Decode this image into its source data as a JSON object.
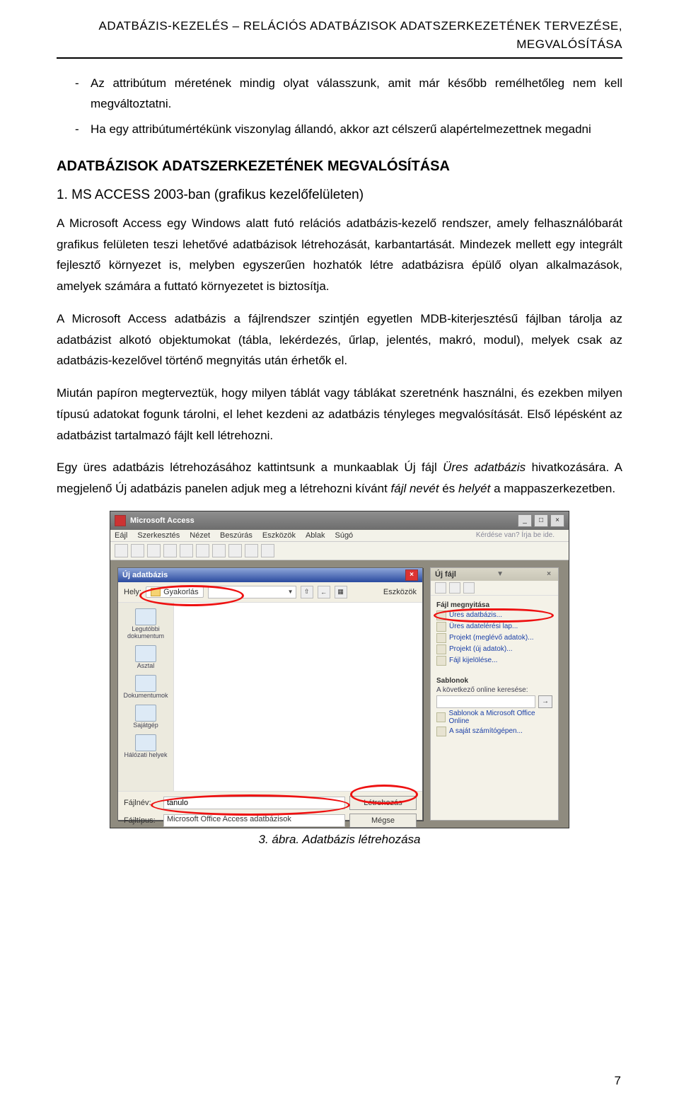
{
  "header": {
    "line1": "ADATBÁZIS-KEZELÉS – RELÁCIÓS ADATBÁZISOK ADATSZERKEZETÉNEK TERVEZÉSE,",
    "line2": "MEGVALÓSÍTÁSA"
  },
  "bullets": {
    "b1": "Az attribútum méretének mindig olyat válasszunk, amit már később remélhetőleg nem kell megváltoztatni.",
    "b2": "Ha egy attribútumértékünk viszonylag állandó, akkor azt célszerű alapértelmezettnek megadni"
  },
  "section": "ADATBÁZISOK ADATSZERKEZETÉNEK MEGVALÓSÍTÁSA",
  "subsection": "1. MS ACCESS 2003-ban (grafikus kezelőfelületen)",
  "paragraphs": {
    "p1": "A Microsoft Access egy Windows alatt futó relációs adatbázis-kezelő rendszer, amely felhasználóbarát grafikus felületen teszi lehetővé adatbázisok létrehozását, karbantartását. Mindezek mellett egy integrált fejlesztő környezet is, melyben egyszerűen hozhatók létre adatbázisra épülő olyan alkalmazások, amelyek számára a futtató környezetet is biztosítja.",
    "p2": "A Microsoft Access adatbázis a fájlrendszer szintjén egyetlen MDB-kiterjesztésű fájlban tárolja az adatbázist alkotó objektumokat (tábla, lekérdezés, űrlap, jelentés, makró, modul), melyek csak az adatbázis-kezelővel történő megnyitás után érhetők el.",
    "p3": "Miután papíron megterveztük, hogy milyen táblát vagy táblákat szeretnénk használni, és ezekben milyen típusú adatokat fogunk tárolni, el lehet kezdeni az adatbázis tényleges megvalósítását. Első lépésként az adatbázist tartalmazó fájlt kell létrehozni.",
    "p4_a": "Egy üres adatbázis létrehozásához kattintsunk a munkaablak Új fájl ",
    "p4_b": "Üres adatbázis",
    "p4_c": " hivatkozására. A megjelenő Új adatbázis panelen adjuk meg a létrehozni kívánt ",
    "p4_d": "fájl nevét",
    "p4_e": " és ",
    "p4_f": "helyét",
    "p4_g": " a mappaszerkezetben."
  },
  "figure": {
    "caption": "3. ábra. Adatbázis létrehozása"
  },
  "app": {
    "title": "Microsoft Access",
    "menus": [
      "Eájl",
      "Szerkesztés",
      "Nézet",
      "Beszúrás",
      "Eszközök",
      "Ablak",
      "Súgó"
    ],
    "question": "Kérdése van? Írja be ide.",
    "dialog": {
      "title": "Új adatbázis",
      "locationLabel": "Hely:",
      "folder": "Gyakorlás",
      "toolsLabel": "Eszközök",
      "places": [
        "Legutóbbi dokumentum",
        "Asztal",
        "Dokumentumok",
        "Sajátgép",
        "Hálózati helyek"
      ],
      "filenameLabel": "Fájlnév:",
      "filenameValue": "tanulo",
      "filetypeLabel": "Fájltípus:",
      "filetypeValue": "Microsoft Office Access adatbázisok",
      "createBtn": "Létrehozás",
      "cancelBtn": "Mégse"
    },
    "pane": {
      "title": "Új fájl",
      "grp1": "Fájl megnyitása",
      "link1": "Üres adatbázis...",
      "link2": "Üres adatelérési lap...",
      "link3": "Projekt (meglévő adatok)...",
      "link4": "Projekt (új adatok)...",
      "link5": "Fájl kijelölése...",
      "grp2": "Sablonok",
      "searchLabel": "A következő online keresése:",
      "link6": "Sablonok a Microsoft Office Online",
      "link7": "A saját számítógépen..."
    }
  },
  "pageNumber": "7"
}
